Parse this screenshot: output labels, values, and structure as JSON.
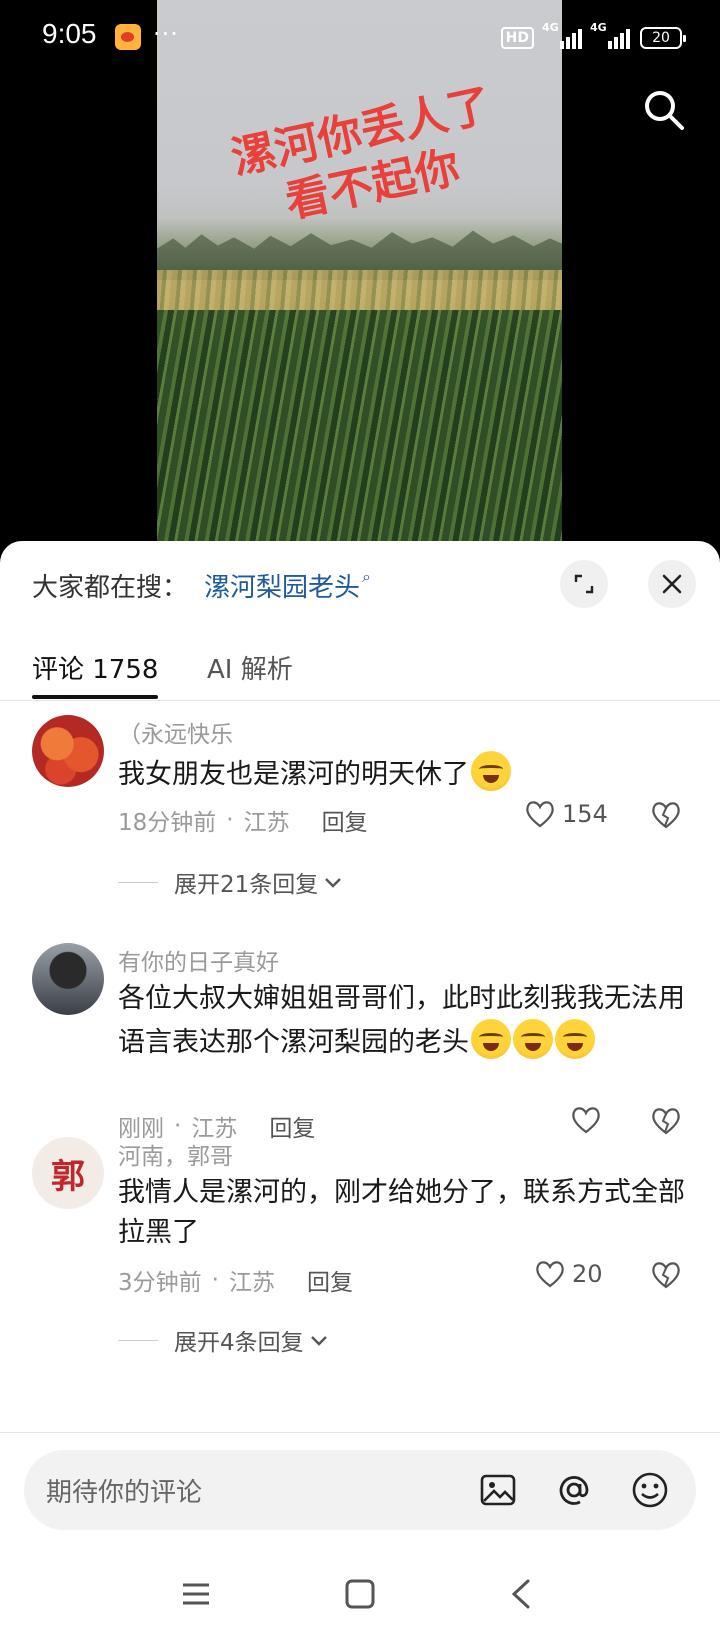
{
  "status_bar": {
    "time": "9:05",
    "dots": "···",
    "hd_label": "HD",
    "network_1": "4G",
    "network_2": "4G",
    "battery": "20"
  },
  "video": {
    "overlay_line_1": "漯河你丢人了",
    "overlay_line_2": "看不起你"
  },
  "hot_search": {
    "label": "大家都在搜：",
    "term": "漯河梨园老头",
    "term_icon": "search-icon"
  },
  "tabs": [
    {
      "label": "评论 1758",
      "active": true
    },
    {
      "label": "AI 解析",
      "active": false
    }
  ],
  "comments": [
    {
      "username": "（永远快乐",
      "text": "我女朋友也是漯河的明天休了",
      "emoji_count": 1,
      "time": "18分钟前",
      "location": "江苏",
      "reply_label": "回复",
      "likes": "154",
      "expand_label": "展开21条回复"
    },
    {
      "username": "有你的日子真好",
      "text": "各位大叔大婶姐姐哥哥们，此时此刻我我无法用语言表达那个漯河梨园的老头",
      "emoji_count": 3,
      "time": "刚刚",
      "location": "江苏",
      "reply_label": "回复",
      "likes": ""
    },
    {
      "username": "河南，郭哥",
      "avatar_text": "郭",
      "text": "我情人是漯河的，刚才给她分了，联系方式全部拉黑了",
      "emoji_count": 0,
      "time": "3分钟前",
      "location": "江苏",
      "reply_label": "回复",
      "likes": "20",
      "expand_label": "展开4条回复"
    }
  ],
  "input": {
    "placeholder": "期待你的评论",
    "icons": [
      "image-icon",
      "at-icon",
      "emoji-icon"
    ]
  },
  "colors": {
    "accent_link": "#1f5a9a",
    "overlay_red": "#e8403b"
  }
}
